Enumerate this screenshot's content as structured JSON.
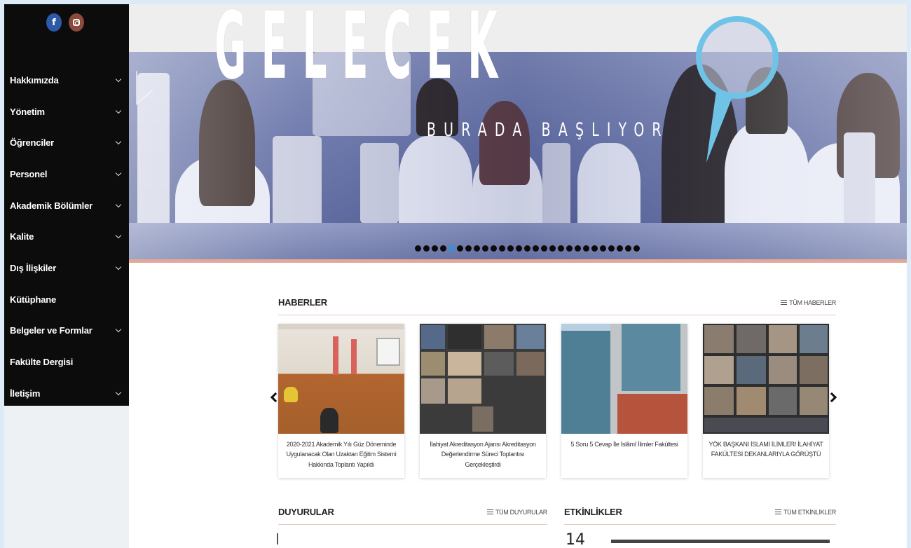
{
  "social": {
    "facebook_icon": "facebook-icon",
    "instagram_icon": "instagram-icon",
    "facebook_glyph": "f"
  },
  "menu": [
    {
      "label": "Hakkımızda",
      "has_submenu": true
    },
    {
      "label": "Yönetim",
      "has_submenu": true
    },
    {
      "label": "Öğrenciler",
      "has_submenu": true
    },
    {
      "label": "Personel",
      "has_submenu": true
    },
    {
      "label": "Akademik Bölümler",
      "has_submenu": true
    },
    {
      "label": "Kalite",
      "has_submenu": true
    },
    {
      "label": "Dış İlişkiler",
      "has_submenu": true
    },
    {
      "label": "Kütüphane",
      "has_submenu": false
    },
    {
      "label": "Belgeler ve Formlar",
      "has_submenu": true
    },
    {
      "label": "Fakülte Dergisi",
      "has_submenu": false
    },
    {
      "label": "İletişim",
      "has_submenu": true
    }
  ],
  "hero": {
    "headline": "GELECEK",
    "subline": "BURADA BAŞLIYOR",
    "slide_count": 27,
    "active_slide": 5
  },
  "news": {
    "title": "HABERLER",
    "all_link": "TÜM HABERLER",
    "items": [
      {
        "caption": "2020-2021 Akademik Yılı Güz Döneminde Uygulanacak Olan Uzaktan Eğitim Sistemi Hakkında Toplantı Yapıldı"
      },
      {
        "caption": "İlahiyat Akreditasyon Ajansı Akreditasyon Değerlendirme Süreci Toplantısı Gerçekleştirdi"
      },
      {
        "caption": "5 Soru 5 Cevap İle İslâmî İlimler Fakültesi"
      },
      {
        "caption": "YÖK BAŞKANI İSLAMİ İLİMLER/ İLAHİYAT FAKÜLTESİ DEKANLARIYLA GÖRÜŞTÜ"
      }
    ]
  },
  "announcements": {
    "title": "DUYURULAR",
    "all_link": "TÜM DUYURULAR"
  },
  "events": {
    "title": "ETKİNLİKLER",
    "all_link": "TÜM ETKİNLİKLER",
    "first_day": "14"
  },
  "colors": {
    "sidebar": "#0c0c0c",
    "accent_line": "#e2a89a",
    "active_dot": "#3a8fd6",
    "page_bg": "#dcebf7"
  }
}
